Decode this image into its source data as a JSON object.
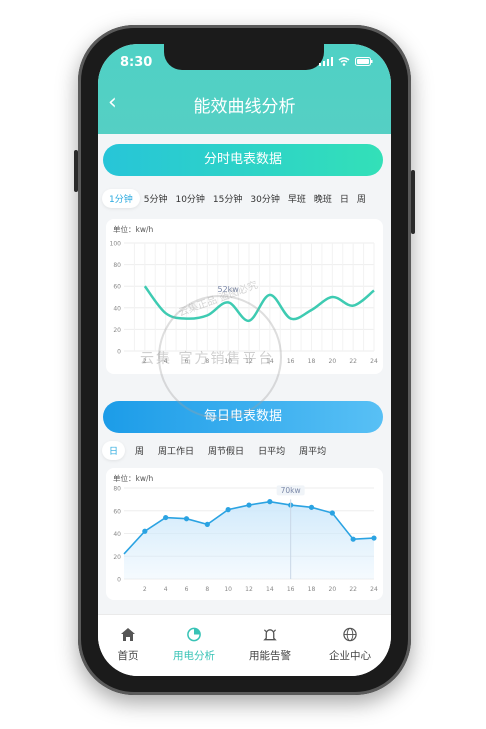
{
  "status": {
    "time": "8:30"
  },
  "header": {
    "title": "能效曲线分析",
    "back_label": "‹"
  },
  "minute_section": {
    "banner": "分时电表数据",
    "tabs": [
      "1分钟",
      "5分钟",
      "10分钟",
      "15分钟",
      "30分钟",
      "早班",
      "晚班",
      "日",
      "周"
    ],
    "active_tab": 0,
    "unit": "单位：kw/h",
    "peak_label": "52kw"
  },
  "daily_section": {
    "banner": "每日电表数据",
    "tabs": [
      "日",
      "周",
      "周工作日",
      "周节假日",
      "日平均",
      "周平均"
    ],
    "active_tab": 0,
    "unit": "单位：kw/h",
    "peak_label": "70kw"
  },
  "chart_data": [
    {
      "type": "line",
      "ylim": [
        0,
        100
      ],
      "y_ticks": [
        0,
        20,
        40,
        60,
        80,
        100
      ],
      "x": [
        2,
        4,
        6,
        8,
        10,
        12,
        14,
        16,
        18,
        20,
        22,
        24
      ],
      "series": [
        {
          "values": [
            60,
            35,
            30,
            33,
            45,
            28,
            52,
            30,
            38,
            50,
            42,
            56
          ]
        }
      ],
      "colors": {
        "line": "#3ecbb2"
      },
      "annotations": [
        {
          "x": 10,
          "y": 52,
          "text": "52kw"
        }
      ]
    },
    {
      "type": "area",
      "ylim": [
        0,
        80
      ],
      "y_ticks": [
        0,
        20,
        40,
        60,
        80
      ],
      "x": [
        0,
        2,
        4,
        6,
        8,
        10,
        12,
        14,
        16,
        18,
        20,
        22,
        24
      ],
      "series": [
        {
          "values": [
            22,
            42,
            54,
            53,
            48,
            61,
            65,
            68,
            65,
            63,
            58,
            35,
            36
          ]
        }
      ],
      "x_ticks": [
        2,
        4,
        6,
        8,
        10,
        12,
        14,
        16,
        18,
        20,
        22,
        24
      ],
      "colors": {
        "line": "#2ba3e2",
        "fill": "#cfe9fb"
      },
      "annotations": [
        {
          "x": 16,
          "y": 70,
          "text": "70kw"
        }
      ]
    }
  ],
  "nav": [
    {
      "label": "首页",
      "icon": "home-icon"
    },
    {
      "label": "用电分析",
      "icon": "pie-chart-icon"
    },
    {
      "label": "用能告警",
      "icon": "bell-icon"
    },
    {
      "label": "企业中心",
      "icon": "globe-icon"
    }
  ],
  "watermark": {
    "brand": "云集 官方销售平台",
    "seal": "云集正品 盗图必究"
  }
}
